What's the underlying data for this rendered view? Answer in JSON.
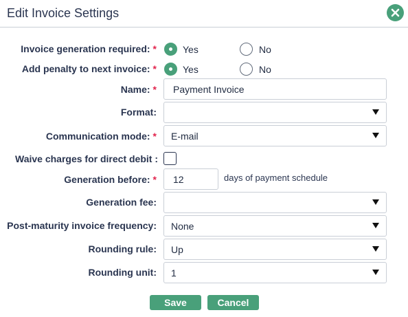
{
  "dialog": {
    "title": "Edit Invoice Settings",
    "close_icon": "close-icon",
    "accent_color": "#49a07a",
    "required_color": "#e2254e"
  },
  "fields": {
    "invoice_generation": {
      "label": "Invoice generation required:",
      "required": "*",
      "options": [
        "Yes",
        "No"
      ],
      "selected": "Yes"
    },
    "add_penalty": {
      "label": "Add penalty to next invoice:",
      "required": "*",
      "options": [
        "Yes",
        "No"
      ],
      "selected": "Yes"
    },
    "name": {
      "label": "Name:",
      "required": "*",
      "value": "Payment Invoice"
    },
    "format": {
      "label": "Format:",
      "value": ""
    },
    "communication_mode": {
      "label": "Communication mode:",
      "required": "*",
      "value": "E-mail"
    },
    "waive_charges": {
      "label": "Waive charges for direct debit :",
      "checked": false
    },
    "generation_before": {
      "label": "Generation before:",
      "required": "*",
      "value": "12",
      "suffix": "days of payment schedule"
    },
    "generation_fee": {
      "label": "Generation fee:",
      "value": ""
    },
    "post_maturity": {
      "label": "Post-maturity invoice frequency:",
      "value": "None"
    },
    "rounding_rule": {
      "label": "Rounding rule:",
      "value": "Up"
    },
    "rounding_unit": {
      "label": "Rounding unit:",
      "value": "1"
    }
  },
  "actions": {
    "save_label": "Save",
    "cancel_label": "Cancel"
  }
}
